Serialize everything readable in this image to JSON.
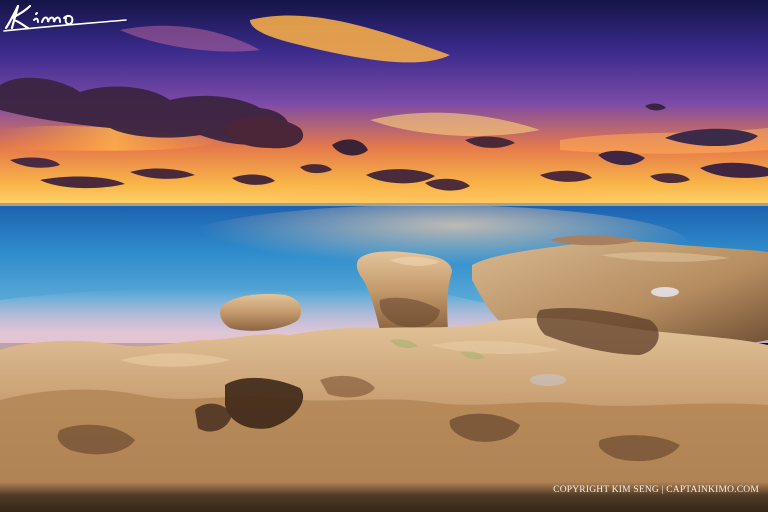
{
  "photo": {
    "scene": "seascape-sunset-rocky-shore",
    "palette": {
      "sky_top": "#1c1a5e",
      "sky_mid": "#5a3aa6",
      "sky_glow": "#f7a43a",
      "horizon": "#ffcf5a",
      "ocean": "#2f8cc8",
      "ocean_deep": "#1a4e9a",
      "mist": "#e6cfe0",
      "rock_light": "#d8b48a",
      "rock_mid": "#b8895e",
      "rock_dark": "#5a3c2a",
      "cloud_dark": "#3a2540"
    }
  },
  "watermark": {
    "signature": "Kimo",
    "copyright": "COPYRIGHT KIM SENG | CAPTAINKIMO.COM"
  }
}
